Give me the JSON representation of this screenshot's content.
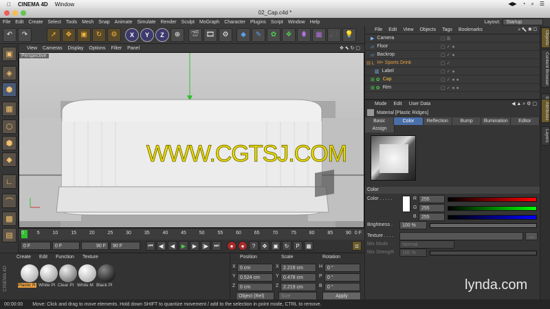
{
  "mac": {
    "app": "CINEMA 4D",
    "menu": "Window",
    "right_items": [
      "◀▶",
      "◔",
      "⌕",
      "☰"
    ]
  },
  "window": {
    "title": "02_Cap.c4d *"
  },
  "menubar": {
    "items": [
      "File",
      "Edit",
      "Create",
      "Select",
      "Tools",
      "Mesh",
      "Snap",
      "Animate",
      "Simulate",
      "Render",
      "Sculpt",
      "MoGraph",
      "Character",
      "Plugins",
      "Script",
      "Window",
      "Help"
    ],
    "layout_label": "Layout:",
    "layout_value": "Startup"
  },
  "toolbar": {
    "axis": [
      "X",
      "Y",
      "Z"
    ]
  },
  "viewport": {
    "menu": [
      "View",
      "Cameras",
      "Display",
      "Options",
      "Filter",
      "Panel"
    ],
    "label": "Perspective",
    "watermark": "WWW.CGTSJ.COM"
  },
  "timeline": {
    "ticks": [
      "0",
      "5",
      "10",
      "15",
      "20",
      "25",
      "30",
      "35",
      "40",
      "45",
      "50",
      "55",
      "60",
      "65",
      "70",
      "75",
      "80",
      "85",
      "90"
    ],
    "end_label": "0 F"
  },
  "transport": {
    "current": "0 F",
    "start": "0 F",
    "end": "90 F",
    "max": "90 F"
  },
  "materials": {
    "menu": [
      "Create",
      "Edit",
      "Function",
      "Texture"
    ],
    "items": [
      "Plastic R",
      "White Pl",
      "Clear Pl",
      "White M",
      "Black Pl"
    ],
    "brand": "CINEMA 4D"
  },
  "coords": {
    "headers": [
      "Position",
      "Scale",
      "Rotation"
    ],
    "rows": [
      {
        "axis": "X",
        "pos": "0 cm",
        "scale": "2.219 cm",
        "rot_axis": "H",
        "rot": "0 °"
      },
      {
        "axis": "Y",
        "pos": "0.524 cm",
        "scale": "0.478 cm",
        "rot_axis": "P",
        "rot": "0 °"
      },
      {
        "axis": "Z",
        "pos": "0 cm",
        "scale": "2.219 cm",
        "rot_axis": "B",
        "rot": "0 °"
      }
    ],
    "mode": "Object (Rel)",
    "size_mode": "Size",
    "apply": "Apply"
  },
  "objects": {
    "menu": [
      "File",
      "Edit",
      "View",
      "Objects",
      "Tags",
      "Bookmarks"
    ],
    "items": [
      {
        "name": "Camera",
        "color": "#ddd"
      },
      {
        "name": "Floor",
        "color": "#ddd"
      },
      {
        "name": "Backrop",
        "color": "#ddd"
      },
      {
        "name": "H+ Sports Drink",
        "color": "#e8a040"
      },
      {
        "name": "Label",
        "color": "#ddd"
      },
      {
        "name": "Cap",
        "color": "#f3c23c"
      },
      {
        "name": "Rim",
        "color": "#ddd"
      }
    ]
  },
  "attributes": {
    "menu": [
      "Mode",
      "Edit",
      "User Data"
    ],
    "title": "Material [Plastic Ridges]",
    "tabs": [
      "Basic",
      "Color",
      "Reflection",
      "Bump",
      "Illumination",
      "Editor"
    ],
    "tab2": "Assign",
    "section": "Color",
    "color_label": "Color . . . . .",
    "r": "255",
    "g": "255",
    "b": "255",
    "brightness_label": "Brightness .",
    "brightness": "100 %",
    "texture_label": "Texture . . . .",
    "mix_mode_label": "Mix Mode . .",
    "mix_mode": "Normal",
    "mix_strength_label": "Mix Strength",
    "mix_strength": "100 %",
    "channel_labels": [
      "R",
      "G",
      "B"
    ]
  },
  "sidetabs": [
    "Objects",
    "Content Browser",
    "Structure",
    "Attributes",
    "Layers"
  ],
  "status": {
    "time": "00:00:00",
    "message": "Move: Click and drag to move elements. Hold down SHIFT to quantize movement / add to the selection in point mode, CTRL to remove."
  },
  "brand": {
    "lynda": "lynda.com"
  },
  "colors": {
    "accent": "#4a6ea8",
    "watermark": "#f2e400",
    "highlight": "#f3c23c"
  }
}
